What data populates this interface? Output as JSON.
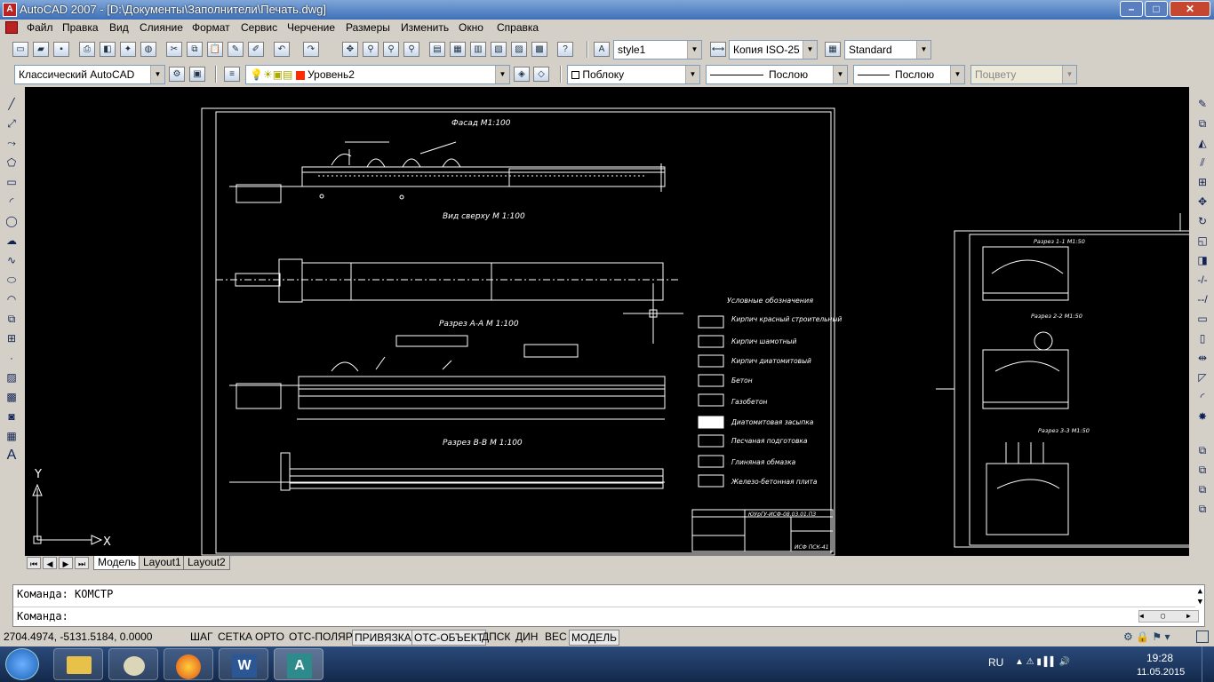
{
  "window": {
    "title": "AutoCAD 2007 - [D:\\Документы\\Заполнители\\Печать.dwg]",
    "app_icon": "A"
  },
  "menu": [
    "Файл",
    "Правка",
    "Вид",
    "Слияние",
    "Формат",
    "Сервис",
    "Черчение",
    "Размеры",
    "Изменить",
    "Окно",
    "Справка"
  ],
  "styles_toolbar": {
    "text_style": "style1",
    "dim_style": "Копия ISO-25",
    "table_style": "Standard"
  },
  "workspaces_toolbar": {
    "workspace": "Классический AutoCAD",
    "layer": "Уровень2",
    "color": "Поблоку",
    "linetype": "Послою",
    "lineweight": "Послою",
    "plotstyle": "Поцвету"
  },
  "drawing": {
    "t_facade": "Фасад М1:100",
    "t_top": "Вид сверху М 1:100",
    "t_aa": "Разрез А-А М 1:100",
    "t_bb": "Разрез В-В М 1:100",
    "legend_title": "Условные обозначения",
    "legend": [
      "Кирпич красный строительный",
      "Кирпич шамотный",
      "Кирпич диатомитовый",
      "Бетон",
      "Газобетон",
      "Диатомитовая засыпка",
      "Песчаная подготовка",
      "Глиняная обмазка",
      "Железо-бетонная плита"
    ],
    "s11": "Разрез 1-1 М1:50",
    "s22": "Разрез 2-2 М1:50",
    "s33": "Разрез 3-3 М1:50",
    "stamp_code": "ЮУрГУ-ИСФ-08.03.01.ПЗ",
    "stamp_sheet": "ИСФ ПСК-41",
    "ucs_x": "X",
    "ucs_y": "Y"
  },
  "tabs": [
    "Модель",
    "Layout1",
    "Layout2"
  ],
  "command": {
    "line1": "Команда: КОМСТР",
    "line2": "Команда:"
  },
  "status": {
    "coords": "2704.4974, -5131.5184, 0.0000",
    "buttons": [
      "ШАГ",
      "СЕТКА",
      "ОРТО",
      "ОТС-ПОЛЯР",
      "ПРИВЯЗКА",
      "ОТС-ОБЪЕКТ",
      "ДПСК",
      "ДИН",
      "ВЕС",
      "МОДЕЛЬ"
    ],
    "active": [
      "ПРИВЯЗКА",
      "ОТС-ОБЪЕКТ",
      "МОДЕЛЬ"
    ]
  },
  "taskbar": {
    "lang": "RU",
    "time": "19:28",
    "date": "11.05.2015"
  },
  "colors": {
    "canvas": "#000000",
    "layer_swatch": "#ff2a00",
    "titlebar": "#3d6fb8"
  }
}
